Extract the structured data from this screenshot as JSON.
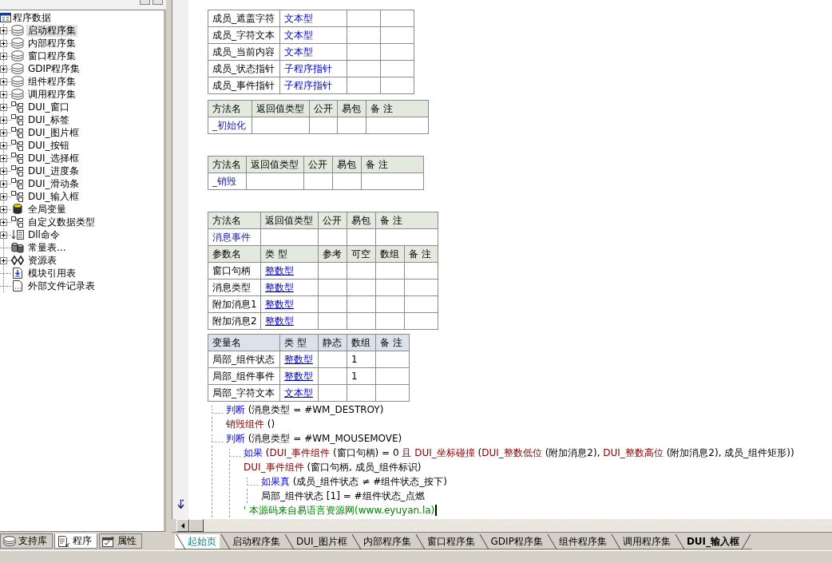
{
  "left_panel": {
    "tree": {
      "kind": "root",
      "label": "程序数据",
      "selected": false,
      "children": [
        {
          "kind": "assembly",
          "label": "启动程序集",
          "expandable": true,
          "selected": true
        },
        {
          "kind": "assembly",
          "label": "内部程序集",
          "expandable": true,
          "selected": false
        },
        {
          "kind": "assembly",
          "label": "窗口程序集",
          "expandable": true,
          "selected": false
        },
        {
          "kind": "assembly",
          "label": "GDIP程序集",
          "expandable": true,
          "selected": false
        },
        {
          "kind": "assembly",
          "label": "组件程序集",
          "expandable": true,
          "selected": false
        },
        {
          "kind": "assembly",
          "label": "调用程序集",
          "expandable": true,
          "selected": false
        },
        {
          "kind": "class",
          "label": "DUI_窗口",
          "expandable": true,
          "selected": false
        },
        {
          "kind": "class",
          "label": "DUI_标签",
          "expandable": true,
          "selected": false
        },
        {
          "kind": "class",
          "label": "DUI_图片框",
          "expandable": true,
          "selected": false
        },
        {
          "kind": "class",
          "label": "DUI_按钮",
          "expandable": true,
          "selected": false
        },
        {
          "kind": "class",
          "label": "DUI_选择框",
          "expandable": true,
          "selected": false
        },
        {
          "kind": "class",
          "label": "DUI_进度条",
          "expandable": true,
          "selected": false
        },
        {
          "kind": "class",
          "label": "DUI_滑动条",
          "expandable": true,
          "selected": false
        },
        {
          "kind": "class",
          "label": "DUI_输入框",
          "expandable": true,
          "selected": false
        },
        {
          "kind": "globals",
          "label": "全局变量",
          "expandable": true,
          "selected": false
        },
        {
          "kind": "class",
          "label": "自定义数据类型",
          "expandable": true,
          "selected": false
        },
        {
          "kind": "dll",
          "label": "Dll命令",
          "expandable": true,
          "selected": false
        },
        {
          "kind": "constants",
          "label": "常量表...",
          "expandable": false,
          "selected": false
        },
        {
          "kind": "resources",
          "label": "资源表",
          "expandable": true,
          "selected": false
        },
        {
          "kind": "module",
          "label": "模块引用表",
          "expandable": false,
          "selected": false
        },
        {
          "kind": "file",
          "label": "外部文件记录表",
          "expandable": false,
          "selected": false
        }
      ]
    },
    "tabs": [
      {
        "kind": "library",
        "label": "支持库",
        "selected": false
      },
      {
        "kind": "program",
        "label": "程序",
        "selected": true
      },
      {
        "kind": "properties",
        "label": "属性",
        "selected": false
      }
    ]
  },
  "editor": {
    "member_table": {
      "rows": [
        {
          "name": "成员_遮盖字符",
          "type": "文本型"
        },
        {
          "name": "成员_字符文本",
          "type": "文本型"
        },
        {
          "name": "成员_当前内容",
          "type": "文本型"
        },
        {
          "name": "成员_状态指针",
          "type": "子程序指针"
        },
        {
          "name": "成员_事件指针",
          "type": "子程序指针"
        }
      ]
    },
    "method_tables": [
      {
        "columns": [
          "方法名",
          "返回值类型",
          "公开",
          "易包",
          "备 注"
        ],
        "method": "_初始化"
      },
      {
        "columns": [
          "方法名",
          "返回值类型",
          "公开",
          "易包",
          "备 注"
        ],
        "method": "_销毁"
      },
      {
        "columns": [
          "方法名",
          "返回值类型",
          "公开",
          "易包",
          "备 注"
        ],
        "method": "消息事件",
        "param_columns": [
          "参数名",
          "类 型",
          "参考",
          "可空",
          "数组",
          "备 注"
        ],
        "params": [
          {
            "name": "窗口句柄",
            "type": "整数型"
          },
          {
            "name": "消息类型",
            "type": "整数型"
          },
          {
            "name": "附加消息1",
            "type": "整数型"
          },
          {
            "name": "附加消息2",
            "type": "整数型"
          }
        ]
      }
    ],
    "variable_table": {
      "columns": [
        "变量名",
        "类 型",
        "静态",
        "数组",
        "备 注"
      ],
      "rows": [
        {
          "name": "局部_组件状态",
          "type": "整数型",
          "array": "1"
        },
        {
          "name": "局部_组件事件",
          "type": "整数型",
          "array": "1"
        },
        {
          "name": "局部_字符文本",
          "type": "文本型"
        }
      ]
    },
    "code": [
      {
        "segments": [
          {
            "kind": "keyword",
            "text": "判断"
          },
          {
            "kind": "plain",
            "text": " (消息类型 = #WM_DESTROY)"
          }
        ],
        "children": [
          {
            "segments": [
              {
                "kind": "command",
                "text": "销毁组件"
              },
              {
                "kind": "plain",
                "text": " ()"
              }
            ]
          }
        ]
      },
      {
        "segments": [
          {
            "kind": "keyword",
            "text": "判断"
          },
          {
            "kind": "plain",
            "text": " (消息类型 = #WM_MOUSEMOVE)"
          }
        ],
        "children": [
          {
            "segments": [
              {
                "kind": "keyword",
                "text": "如果"
              },
              {
                "kind": "plain",
                "text": " ("
              },
              {
                "kind": "command",
                "text": "DUI_事件组件"
              },
              {
                "kind": "plain",
                "text": " (窗口句柄) = 0 "
              },
              {
                "kind": "command",
                "text": "且 DUI_坐标碰撞"
              },
              {
                "kind": "plain",
                "text": " ("
              },
              {
                "kind": "command",
                "text": "DUI_整数低位"
              },
              {
                "kind": "plain",
                "text": " (附加消息2), "
              },
              {
                "kind": "command",
                "text": "DUI_整数高位"
              },
              {
                "kind": "plain",
                "text": " (附加消息2), 成员_组件矩形))"
              }
            ],
            "children": [
              {
                "segments": [
                  {
                    "kind": "command",
                    "text": "DUI_事件组件"
                  },
                  {
                    "kind": "plain",
                    "text": " (窗口句柄, 成员_组件标识)"
                  }
                ]
              },
              {
                "segments": [
                  {
                    "kind": "keyword",
                    "text": "如果真"
                  },
                  {
                    "kind": "plain",
                    "text": " (成员_组件状态 ≠ #组件状态_按下)"
                  }
                ],
                "children": [
                  {
                    "segments": [
                      {
                        "kind": "plain",
                        "text": "局部_组件状态 [1] = #组件状态_点燃"
                      }
                    ]
                  }
                ]
              },
              {
                "segments": [
                  {
                    "kind": "comment",
                    "text": "' 本源码来自易语言资源网(www.eyuyan.la)"
                  }
                ],
                "caret": true
              }
            ]
          }
        ]
      }
    ],
    "tabs": [
      {
        "kind": "start",
        "label": "起始页",
        "selected": false
      },
      {
        "kind": "code",
        "label": "启动程序集",
        "selected": false
      },
      {
        "kind": "code",
        "label": "DUI_图片框",
        "selected": false
      },
      {
        "kind": "code",
        "label": "内部程序集",
        "selected": false
      },
      {
        "kind": "code",
        "label": "窗口程序集",
        "selected": false
      },
      {
        "kind": "code",
        "label": "GDIP程序集",
        "selected": false
      },
      {
        "kind": "code",
        "label": "组件程序集",
        "selected": false
      },
      {
        "kind": "code",
        "label": "调用程序集",
        "selected": false
      },
      {
        "kind": "code",
        "label": "DUI_输入框",
        "selected": true
      }
    ]
  }
}
